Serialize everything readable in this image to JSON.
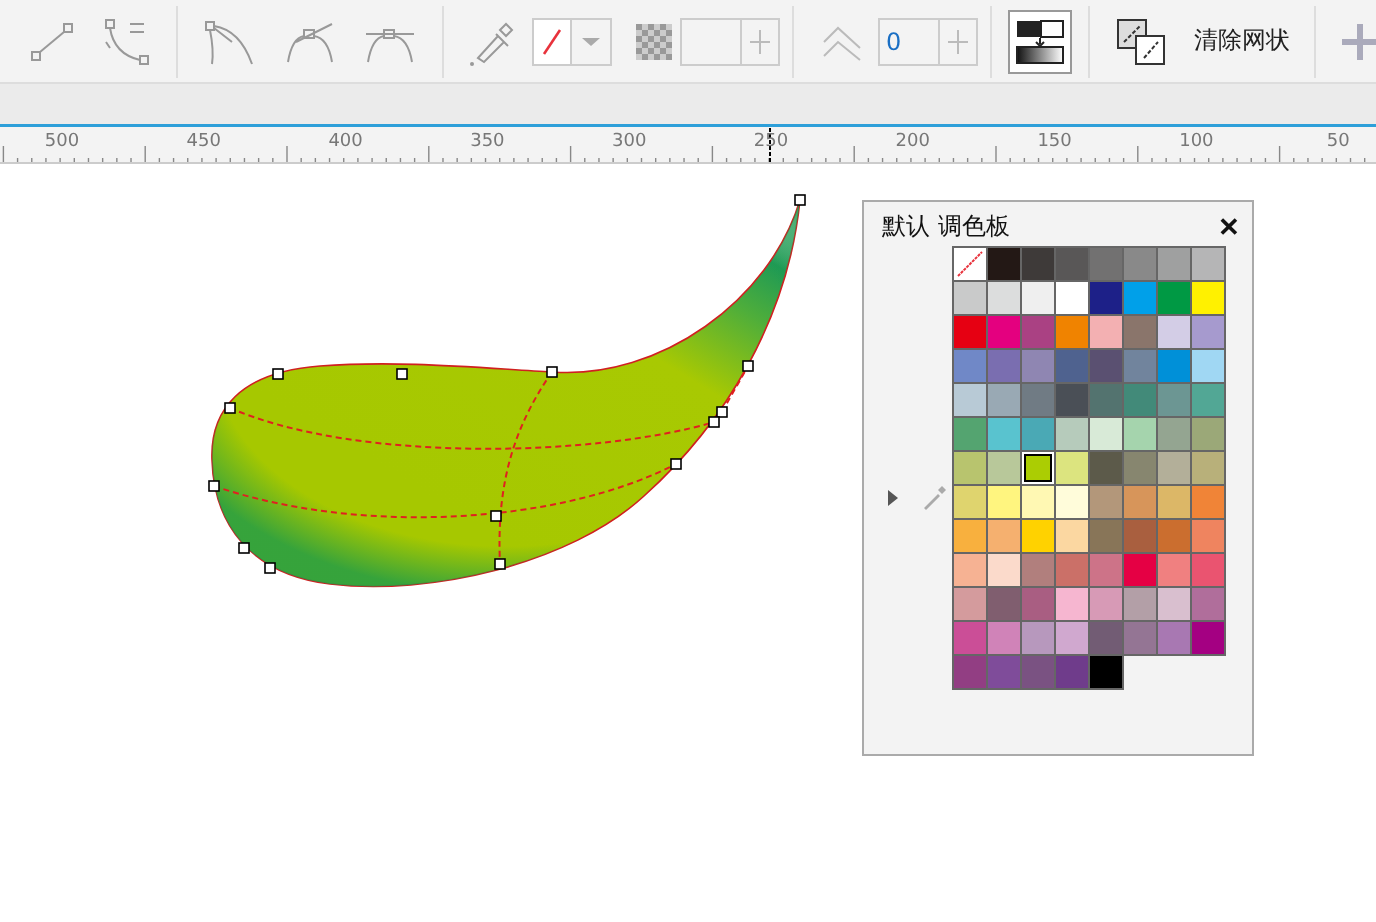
{
  "toolbar": {
    "outline_color": {
      "kind": "none"
    },
    "smoothing_field": {
      "value": "0"
    },
    "mesh_button": {
      "selected": true
    },
    "clear_mesh_label": "清除网状"
  },
  "ruler": {
    "labels": [
      "500",
      "450",
      "400",
      "350",
      "300",
      "250",
      "200",
      "150",
      "100",
      "50"
    ]
  },
  "palette": {
    "title": "默认 调色板",
    "close": "✕",
    "swatches": [
      {
        "kind": "none",
        "color": "#ffffff",
        "selected": false
      },
      {
        "kind": "color",
        "color": "#231815",
        "selected": false
      },
      {
        "kind": "color",
        "color": "#3e3a39",
        "selected": false
      },
      {
        "kind": "color",
        "color": "#595757",
        "selected": false
      },
      {
        "kind": "color",
        "color": "#727171",
        "selected": false
      },
      {
        "kind": "color",
        "color": "#898989",
        "selected": false
      },
      {
        "kind": "color",
        "color": "#9fa0a0",
        "selected": false
      },
      {
        "kind": "color",
        "color": "#b5b5b6",
        "selected": false
      },
      {
        "kind": "color",
        "color": "#c9caca",
        "selected": false
      },
      {
        "kind": "color",
        "color": "#dcdddd",
        "selected": false
      },
      {
        "kind": "color",
        "color": "#efefef",
        "selected": false
      },
      {
        "kind": "color",
        "color": "#ffffff",
        "selected": false
      },
      {
        "kind": "color",
        "color": "#1d2088",
        "selected": false
      },
      {
        "kind": "color",
        "color": "#00a0e9",
        "selected": false
      },
      {
        "kind": "color",
        "color": "#009944",
        "selected": false
      },
      {
        "kind": "color",
        "color": "#fff100",
        "selected": false
      },
      {
        "kind": "color",
        "color": "#e60012",
        "selected": false
      },
      {
        "kind": "color",
        "color": "#e4007f",
        "selected": false
      },
      {
        "kind": "color",
        "color": "#aa4183",
        "selected": false
      },
      {
        "kind": "color",
        "color": "#f08300",
        "selected": false
      },
      {
        "kind": "color",
        "color": "#f3b0b2",
        "selected": false
      },
      {
        "kind": "color",
        "color": "#8a756b",
        "selected": false
      },
      {
        "kind": "color",
        "color": "#d3cde6",
        "selected": false
      },
      {
        "kind": "color",
        "color": "#a69ace",
        "selected": false
      },
      {
        "kind": "color",
        "color": "#7088c7",
        "selected": false
      },
      {
        "kind": "color",
        "color": "#7a6eb0",
        "selected": false
      },
      {
        "kind": "color",
        "color": "#8f86b2",
        "selected": false
      },
      {
        "kind": "color",
        "color": "#4f628f",
        "selected": false
      },
      {
        "kind": "color",
        "color": "#5a5071",
        "selected": false
      },
      {
        "kind": "color",
        "color": "#71849d",
        "selected": false
      },
      {
        "kind": "color",
        "color": "#0090d8",
        "selected": false
      },
      {
        "kind": "color",
        "color": "#a0d7f3",
        "selected": false
      },
      {
        "kind": "color",
        "color": "#b8cad6",
        "selected": false
      },
      {
        "kind": "color",
        "color": "#99a9b4",
        "selected": false
      },
      {
        "kind": "color",
        "color": "#707b84",
        "selected": false
      },
      {
        "kind": "color",
        "color": "#4a4f56",
        "selected": false
      },
      {
        "kind": "color",
        "color": "#53736f",
        "selected": false
      },
      {
        "kind": "color",
        "color": "#428a79",
        "selected": false
      },
      {
        "kind": "color",
        "color": "#6c9693",
        "selected": false
      },
      {
        "kind": "color",
        "color": "#52a795",
        "selected": false
      },
      {
        "kind": "color",
        "color": "#54a470",
        "selected": false
      },
      {
        "kind": "color",
        "color": "#59c3cf",
        "selected": false
      },
      {
        "kind": "color",
        "color": "#4aa9b5",
        "selected": false
      },
      {
        "kind": "color",
        "color": "#b6cbbb",
        "selected": false
      },
      {
        "kind": "color",
        "color": "#d8ead7",
        "selected": false
      },
      {
        "kind": "color",
        "color": "#a5d4ad",
        "selected": false
      },
      {
        "kind": "color",
        "color": "#94a591",
        "selected": false
      },
      {
        "kind": "color",
        "color": "#9ba878",
        "selected": false
      },
      {
        "kind": "color",
        "color": "#b8c46e",
        "selected": false
      },
      {
        "kind": "color",
        "color": "#b8c89a",
        "selected": false
      },
      {
        "kind": "color",
        "color": "#abcd03",
        "selected": true
      },
      {
        "kind": "color",
        "color": "#dce47f",
        "selected": false
      },
      {
        "kind": "color",
        "color": "#5c5a4a",
        "selected": false
      },
      {
        "kind": "color",
        "color": "#87866f",
        "selected": false
      },
      {
        "kind": "color",
        "color": "#b3af99",
        "selected": false
      },
      {
        "kind": "color",
        "color": "#b8b07a",
        "selected": false
      },
      {
        "kind": "color",
        "color": "#dfd46e",
        "selected": false
      },
      {
        "kind": "color",
        "color": "#fff57f",
        "selected": false
      },
      {
        "kind": "color",
        "color": "#fff8b3",
        "selected": false
      },
      {
        "kind": "color",
        "color": "#fffcda",
        "selected": false
      },
      {
        "kind": "color",
        "color": "#b3977a",
        "selected": false
      },
      {
        "kind": "color",
        "color": "#d7955a",
        "selected": false
      },
      {
        "kind": "color",
        "color": "#dcb767",
        "selected": false
      },
      {
        "kind": "color",
        "color": "#f08437",
        "selected": false
      },
      {
        "kind": "color",
        "color": "#f8b03e",
        "selected": false
      },
      {
        "kind": "color",
        "color": "#f5b06f",
        "selected": false
      },
      {
        "kind": "color",
        "color": "#ffd200",
        "selected": false
      },
      {
        "kind": "color",
        "color": "#fbd7a1",
        "selected": false
      },
      {
        "kind": "color",
        "color": "#887558",
        "selected": false
      },
      {
        "kind": "color",
        "color": "#a95f3f",
        "selected": false
      },
      {
        "kind": "color",
        "color": "#cb6e2f",
        "selected": false
      },
      {
        "kind": "color",
        "color": "#ef845f",
        "selected": false
      },
      {
        "kind": "color",
        "color": "#f6b293",
        "selected": false
      },
      {
        "kind": "color",
        "color": "#fbdacb",
        "selected": false
      },
      {
        "kind": "color",
        "color": "#b17f7d",
        "selected": false
      },
      {
        "kind": "color",
        "color": "#cb7068",
        "selected": false
      },
      {
        "kind": "color",
        "color": "#cd7388",
        "selected": false
      },
      {
        "kind": "color",
        "color": "#e50044",
        "selected": false
      },
      {
        "kind": "color",
        "color": "#f08080",
        "selected": false
      },
      {
        "kind": "color",
        "color": "#ea5470",
        "selected": false
      },
      {
        "kind": "color",
        "color": "#d49b9d",
        "selected": false
      },
      {
        "kind": "color",
        "color": "#805e6f",
        "selected": false
      },
      {
        "kind": "color",
        "color": "#a95e82",
        "selected": false
      },
      {
        "kind": "color",
        "color": "#f6b6d0",
        "selected": false
      },
      {
        "kind": "color",
        "color": "#d79ab6",
        "selected": false
      },
      {
        "kind": "color",
        "color": "#b39fa7",
        "selected": false
      },
      {
        "kind": "color",
        "color": "#d9bfcf",
        "selected": false
      },
      {
        "kind": "color",
        "color": "#b06e9b",
        "selected": false
      },
      {
        "kind": "color",
        "color": "#cb4e97",
        "selected": false
      },
      {
        "kind": "color",
        "color": "#d083b8",
        "selected": false
      },
      {
        "kind": "color",
        "color": "#b798bd",
        "selected": false
      },
      {
        "kind": "color",
        "color": "#d0a8cf",
        "selected": false
      },
      {
        "kind": "color",
        "color": "#725c74",
        "selected": false
      },
      {
        "kind": "color",
        "color": "#947594",
        "selected": false
      },
      {
        "kind": "color",
        "color": "#a878b2",
        "selected": false
      },
      {
        "kind": "color",
        "color": "#a40082",
        "selected": false
      },
      {
        "kind": "color",
        "color": "#923e83",
        "selected": false
      },
      {
        "kind": "color",
        "color": "#7f4c9a",
        "selected": false
      },
      {
        "kind": "color",
        "color": "#7a5282",
        "selected": false
      },
      {
        "kind": "color",
        "color": "#6f3c8b",
        "selected": false
      },
      {
        "kind": "color",
        "color": "#000000",
        "selected": false
      }
    ]
  }
}
